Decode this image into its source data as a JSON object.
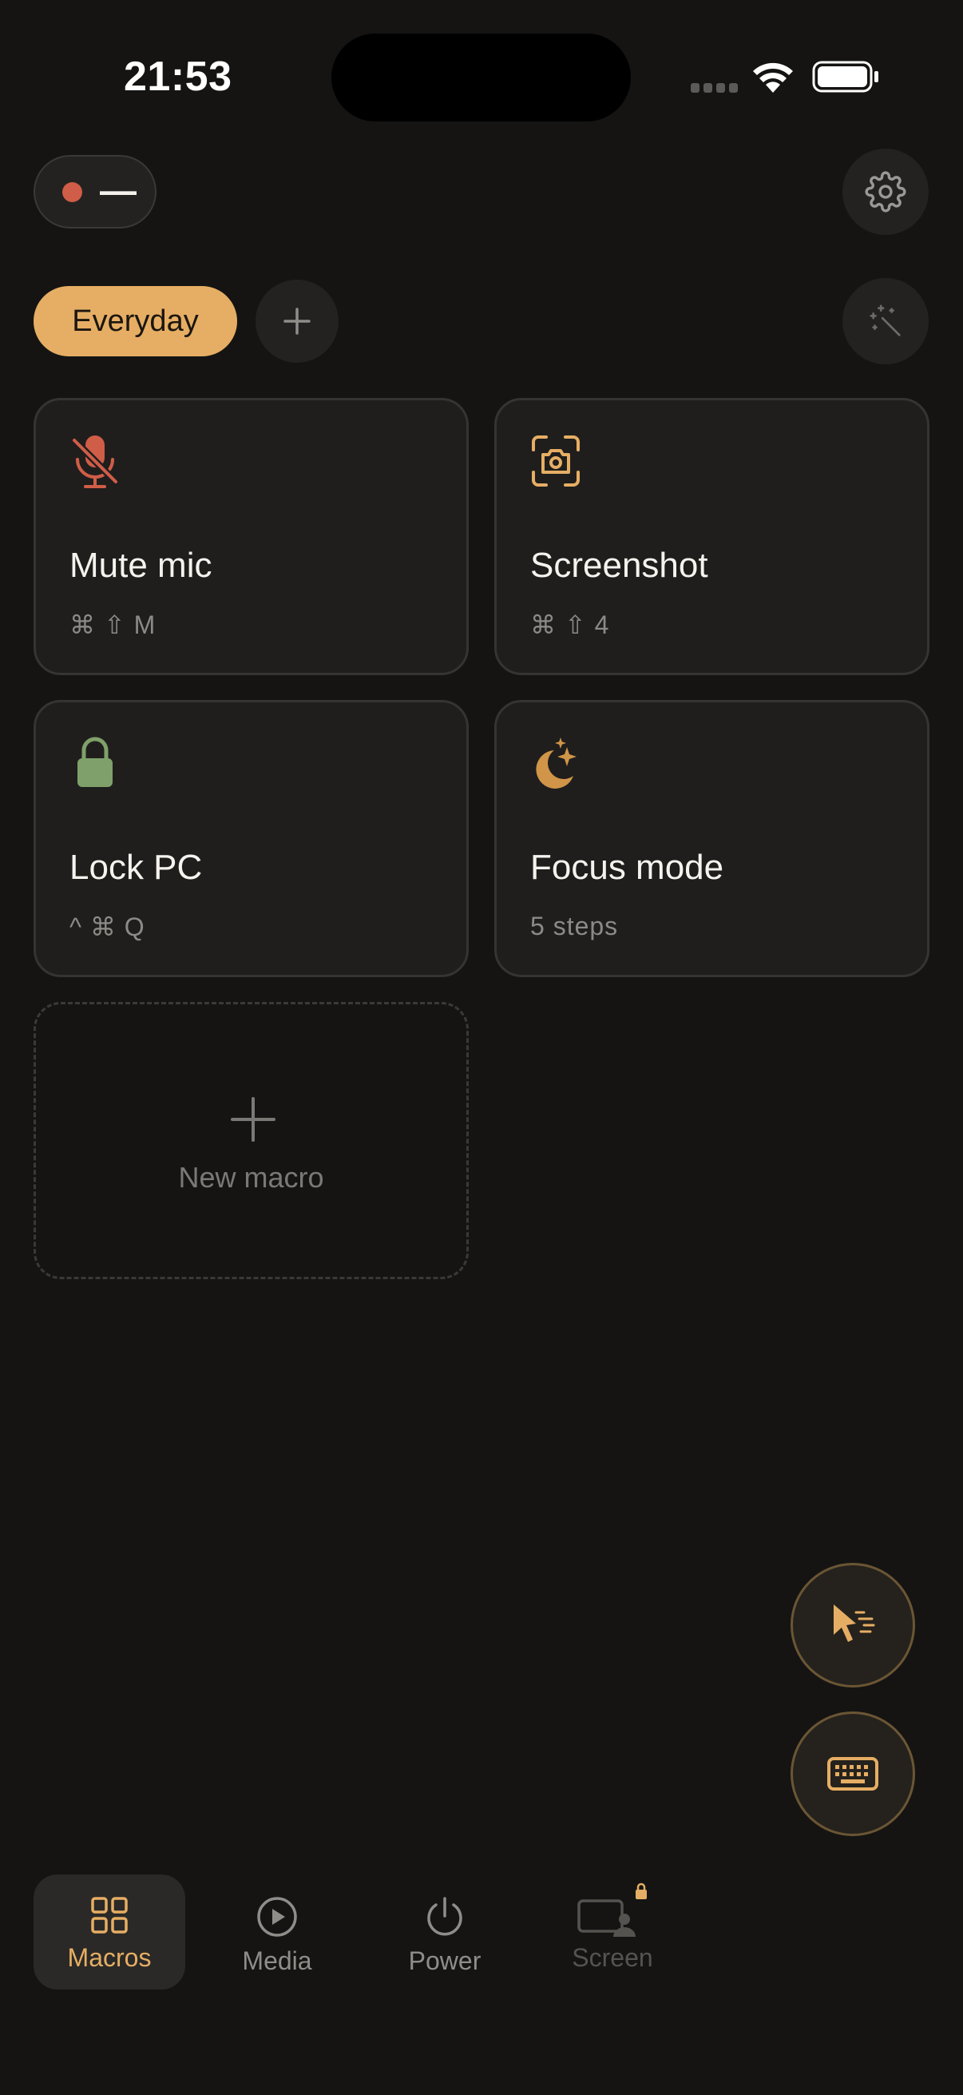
{
  "status_bar": {
    "time": "21:53"
  },
  "connection": {
    "label": "—",
    "dot_color": "#d05d47"
  },
  "tabs": {
    "active_label": "Everyday"
  },
  "macros": [
    {
      "title": "Mute mic",
      "shortcut": "⌘ ⇧ M",
      "icon": "mic-off-icon",
      "icon_color": "#d05d47"
    },
    {
      "title": "Screenshot",
      "shortcut": "⌘ ⇧ 4",
      "icon": "camera-scan-icon",
      "icon_color": "#e6ae64"
    },
    {
      "title": "Lock PC",
      "shortcut": "^ ⌘ Q",
      "icon": "lock-icon",
      "icon_color": "#7fa06a"
    },
    {
      "title": "Focus mode",
      "shortcut": "5 steps",
      "icon": "moon-stars-icon",
      "icon_color": "#d09548"
    }
  ],
  "new_macro": {
    "label": "New macro"
  },
  "nav": {
    "macros": "Macros",
    "media": "Media",
    "power": "Power",
    "screen": "Screen"
  },
  "colors": {
    "accent": "#e6ae64",
    "background": "#151413",
    "card": "#1f1e1d"
  }
}
